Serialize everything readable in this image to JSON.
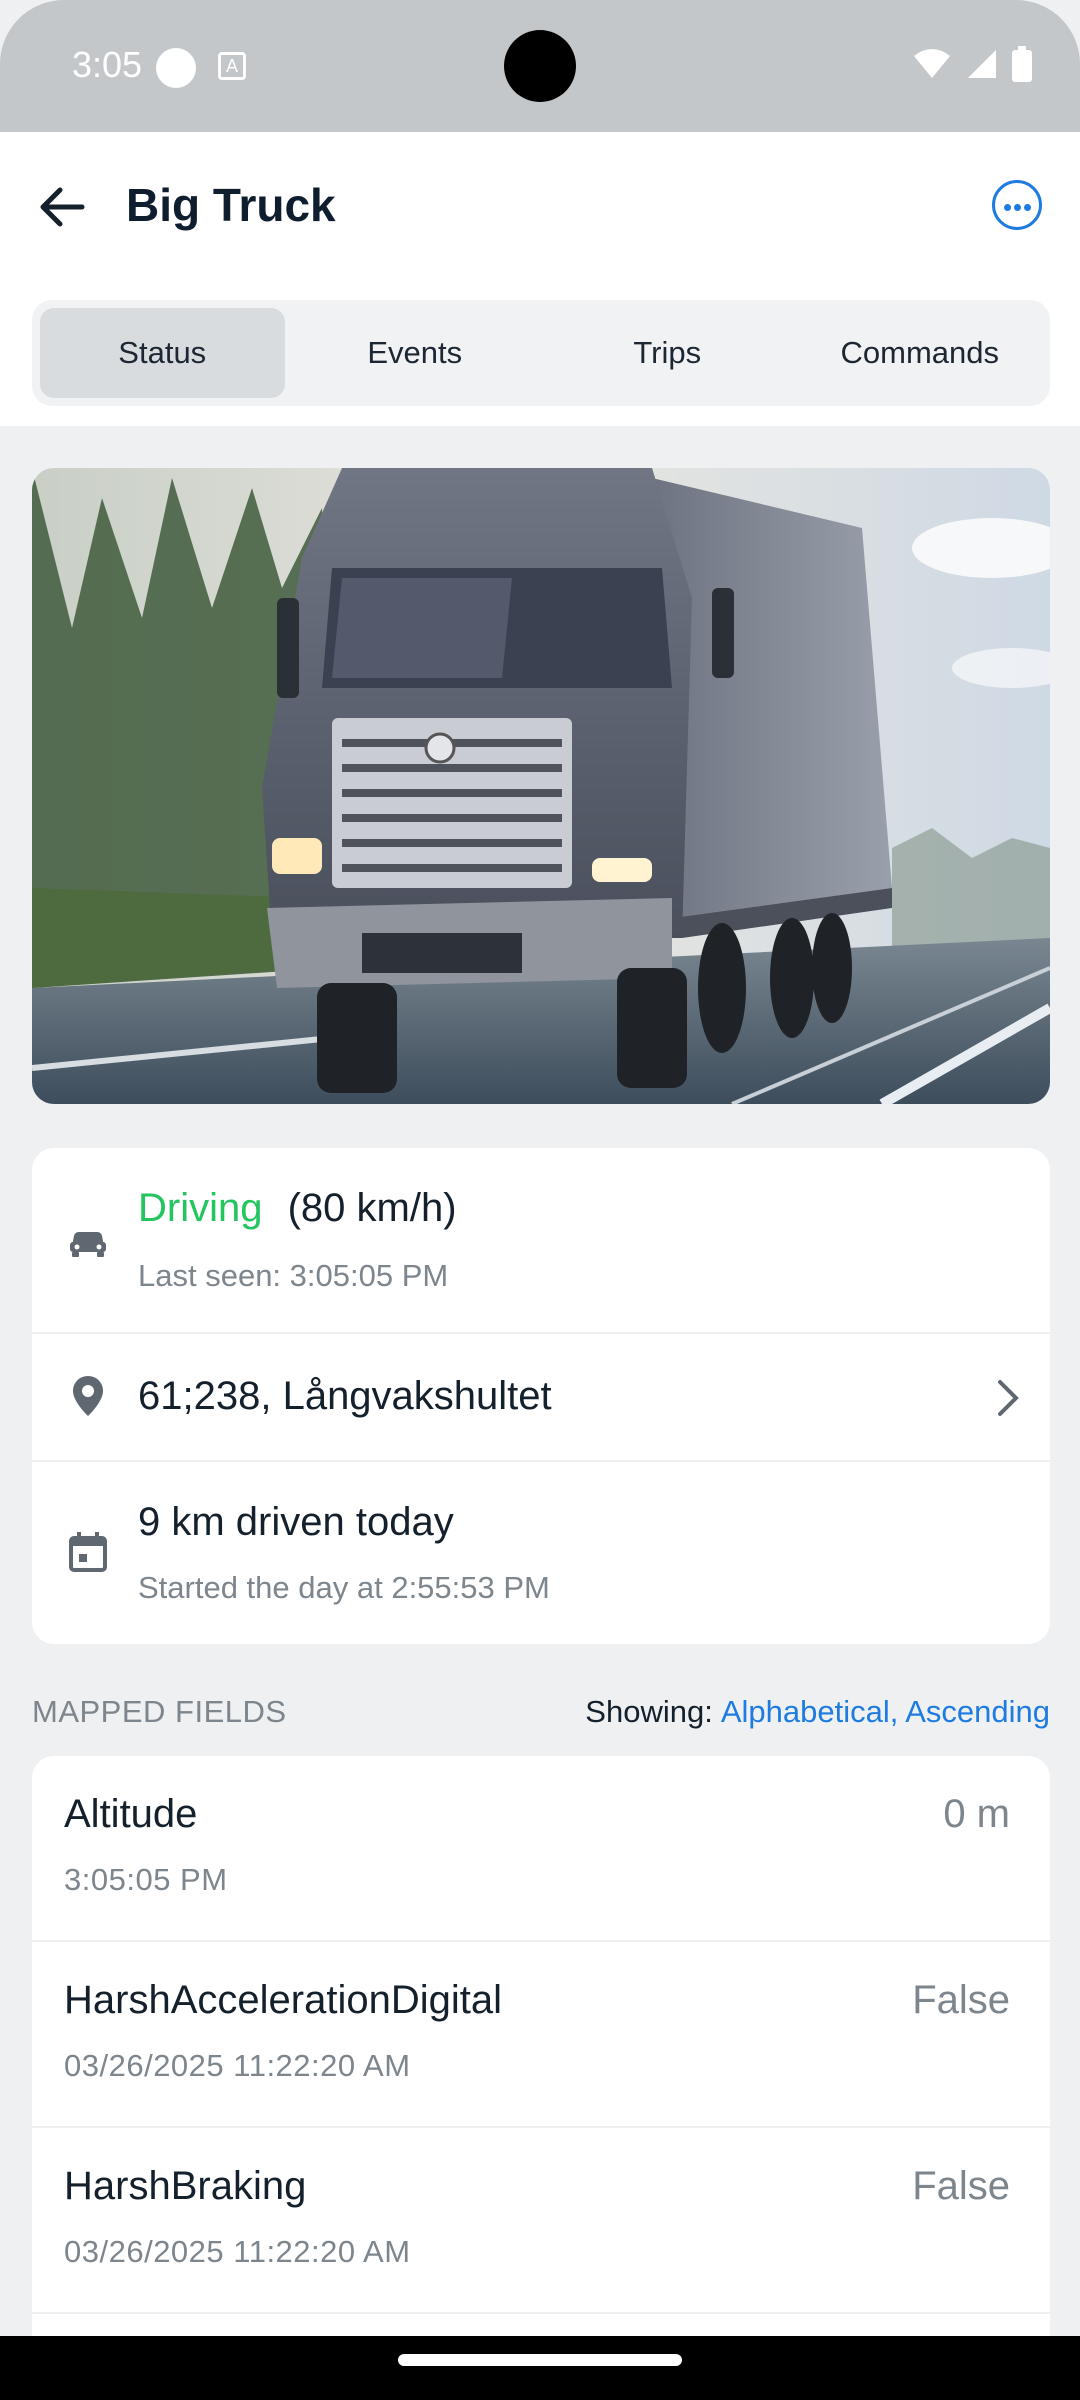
{
  "status_bar": {
    "time": "3:05"
  },
  "header": {
    "title": "Big Truck"
  },
  "tabs": [
    {
      "label": "Status"
    },
    {
      "label": "Events"
    },
    {
      "label": "Trips"
    },
    {
      "label": "Commands"
    }
  ],
  "info": {
    "status_label": "Driving",
    "speed": "(80 km/h)",
    "last_seen": "Last seen: 3:05:05 PM",
    "location": "61;238, Långvakshultet",
    "distance": "9 km driven today",
    "day_start": "Started the day at 2:55:53 PM"
  },
  "mapped_fields": {
    "heading": "MAPPED FIELDS",
    "sort_label": "Showing:",
    "sort_value": "Alphabetical, Ascending",
    "items": [
      {
        "name": "Altitude",
        "time": "3:05:05 PM",
        "value": "0 m"
      },
      {
        "name": "HarshAccelerationDigital",
        "time": "03/26/2025 11:22:20 AM",
        "value": "False"
      },
      {
        "name": "HarshBraking",
        "time": "03/26/2025 11:22:20 AM",
        "value": "False"
      }
    ]
  },
  "colors": {
    "accent": "#1e7be0",
    "driving": "#22c55e"
  }
}
